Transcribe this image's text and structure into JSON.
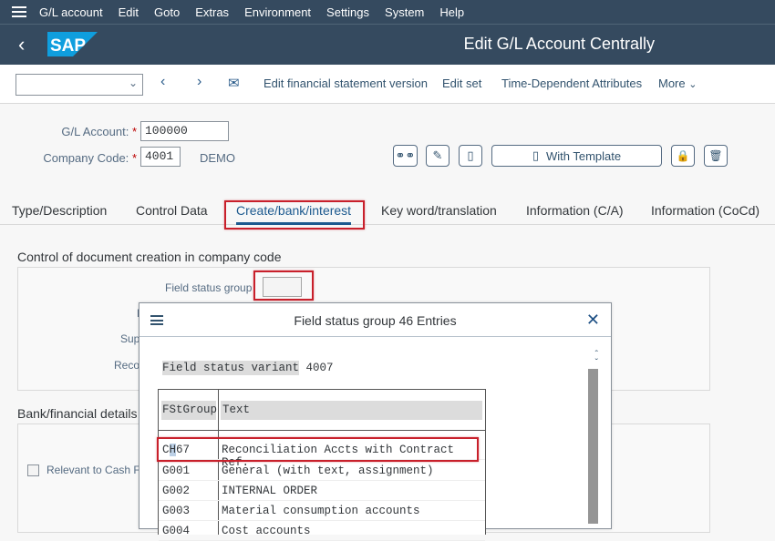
{
  "menubar": {
    "items": [
      "G/L account",
      "Edit",
      "Goto",
      "Extras",
      "Environment",
      "Settings",
      "System",
      "Help"
    ]
  },
  "shell": {
    "logo_text": "SAP",
    "title": "Edit G/L Account Centrally"
  },
  "toolbar": {
    "combo_value": "",
    "buttons": [
      "Edit financial statement version",
      "Edit set",
      "Time-Dependent Attributes",
      "More"
    ]
  },
  "header_fields": {
    "gl_account_label": "G/L Account:",
    "gl_account_value": "100000",
    "company_code_label": "Company Code:",
    "company_code_value": "4001",
    "company_code_desc": "DEMO",
    "required_mark": "*",
    "with_template_label": "With Template"
  },
  "tabs": [
    {
      "label": "Type/Description",
      "active": false
    },
    {
      "label": "Control Data",
      "active": false
    },
    {
      "label": "Create/bank/interest",
      "active": true
    },
    {
      "label": "Key word/translation",
      "active": false
    },
    {
      "label": "Information (C/A)",
      "active": false
    },
    {
      "label": "Information (CoCd)",
      "active": false
    }
  ],
  "doc_creation": {
    "title": "Control of document creation in company code",
    "field_status_group_label": "Field status group",
    "field_status_group_value": "",
    "partial_labels": [
      "P",
      "Sup",
      "Reco"
    ]
  },
  "bank": {
    "title": "Bank/financial details",
    "relevant_cash_label": "Relevant to Cash F",
    "relevant_cash_checked": false
  },
  "popup": {
    "title": "Field status group 46 Entries",
    "variant_label": "Field status variant",
    "variant_value": "4007",
    "columns": [
      "FStGroup",
      "Text"
    ],
    "rows": [
      {
        "group": "CH67",
        "text": "Reconciliation Accts with Contract Ref.",
        "selected": true
      },
      {
        "group": "G001",
        "text": "General (with text, assignment)",
        "selected": false
      },
      {
        "group": "G002",
        "text": "INTERNAL ORDER",
        "selected": false
      },
      {
        "group": "G003",
        "text": "Material consumption accounts",
        "selected": false
      },
      {
        "group": "G004",
        "text": "Cost accounts",
        "selected": false
      }
    ]
  },
  "colors": {
    "shell_bg": "#354a5f",
    "accent": "#1d5a8f",
    "highlight_border": "#c8202b",
    "sap_logo_blue": "#0f9ede"
  }
}
